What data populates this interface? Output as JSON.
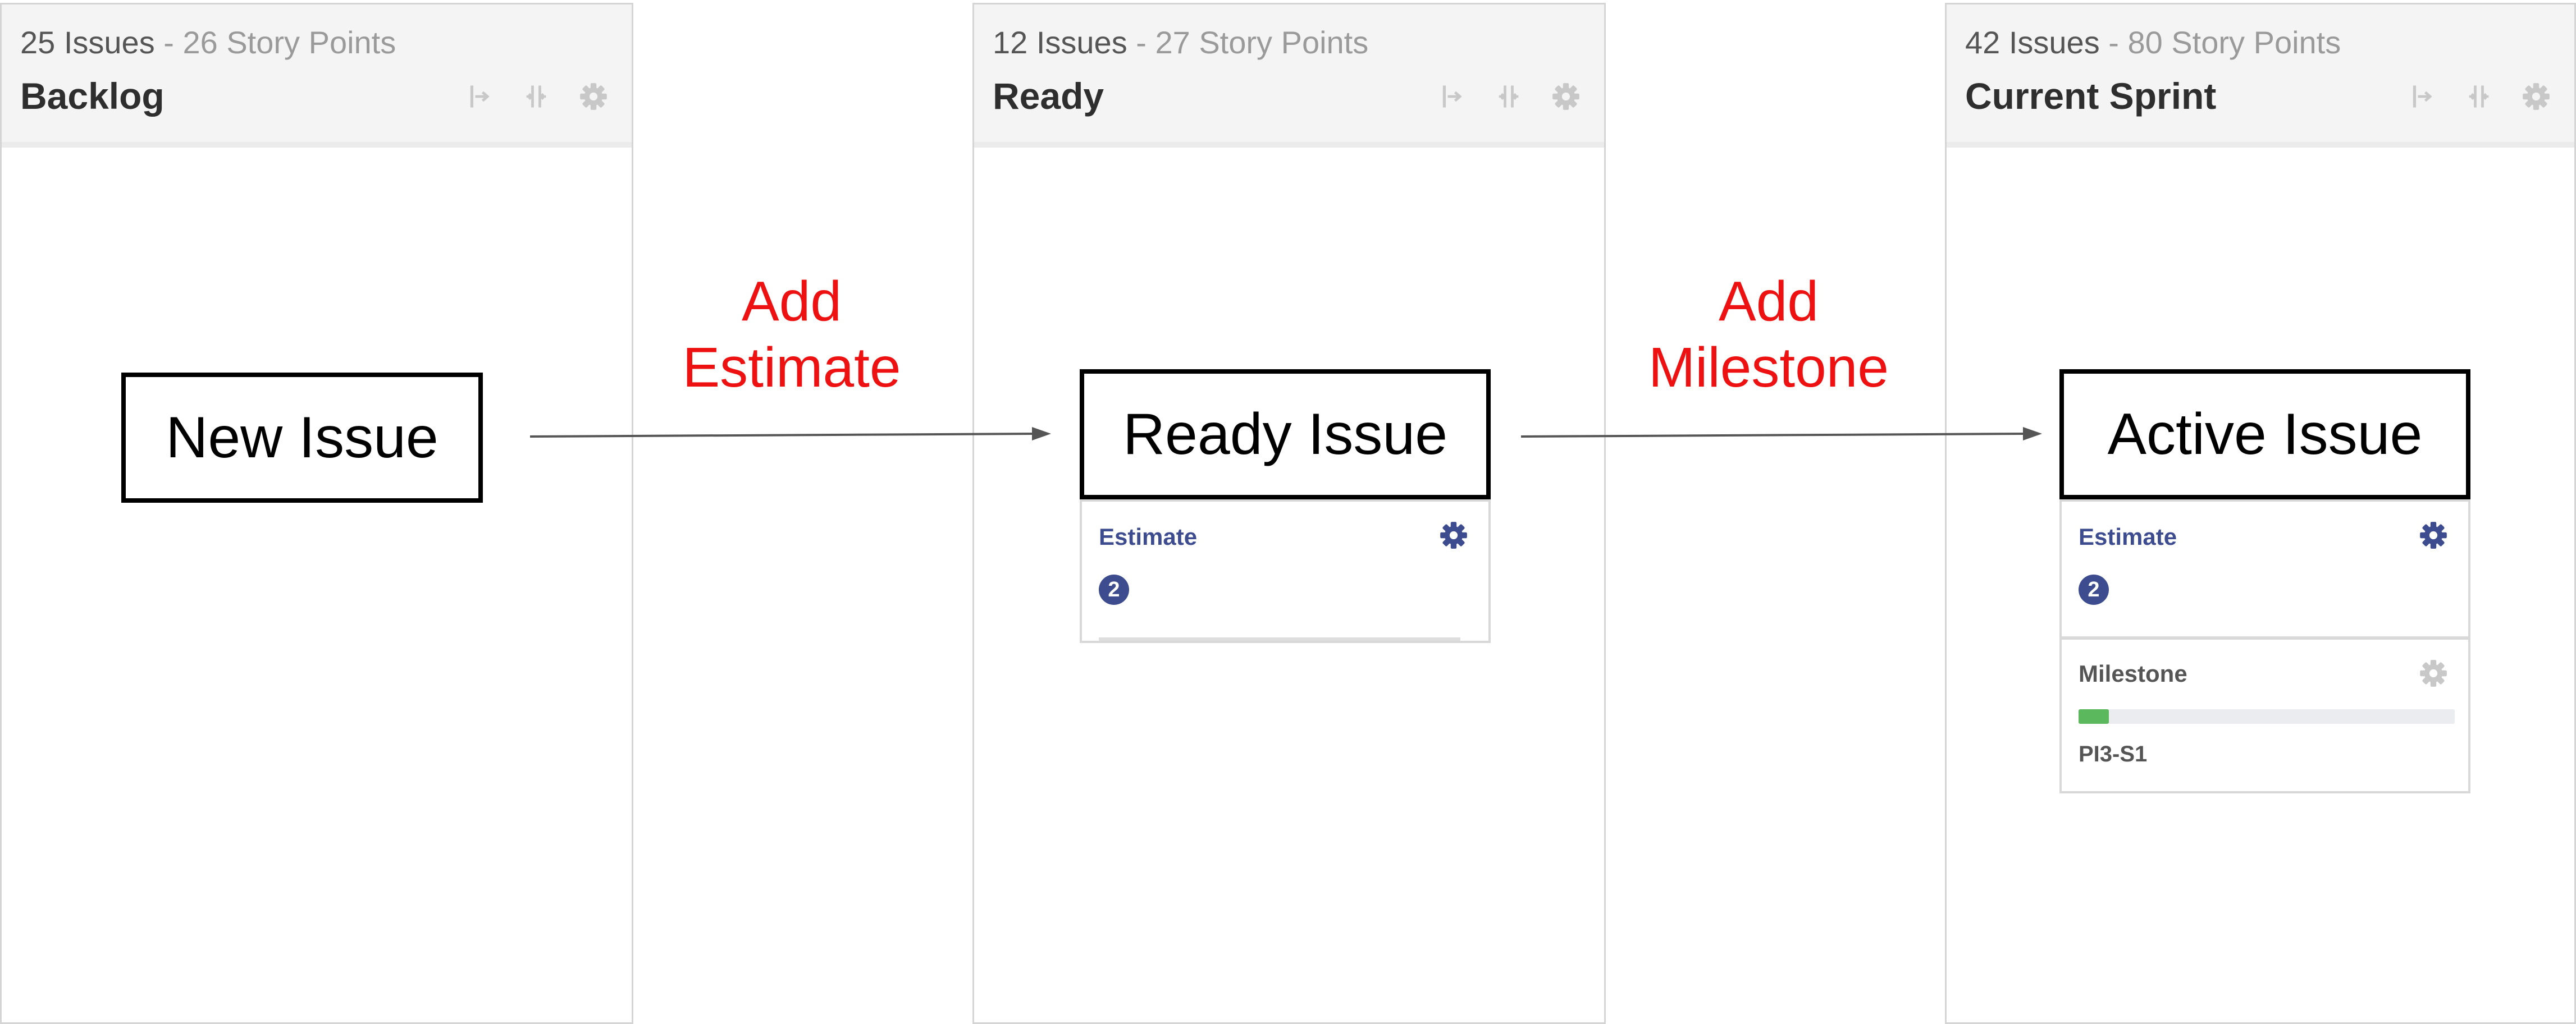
{
  "columns": {
    "backlog": {
      "issues": "25 Issues",
      "separator": "-",
      "points": "26 Story Points",
      "title": "Backlog"
    },
    "ready": {
      "issues": "12 Issues",
      "separator": "-",
      "points": "27 Story Points",
      "title": "Ready"
    },
    "sprint": {
      "issues": "42 Issues",
      "separator": "-",
      "points": "80 Story Points",
      "title": "Current Sprint"
    },
    "tool_icons": [
      "collapse-icon",
      "compress-icon",
      "gear-icon"
    ]
  },
  "stages": {
    "new": "New Issue",
    "ready": "Ready Issue",
    "active": "Active Issue"
  },
  "transitions": {
    "estimate": {
      "line1": "Add",
      "line2": "Estimate"
    },
    "milestone": {
      "line1": "Add",
      "line2": "Milestone"
    }
  },
  "panels": {
    "ready_estimate": {
      "label": "Estimate",
      "value": "2"
    },
    "active_estimate": {
      "label": "Estimate",
      "value": "2"
    },
    "milestone": {
      "label": "Milestone",
      "name": "PI3-S1",
      "progress_percent": 8
    }
  },
  "colors": {
    "accent": "#3d4b8f",
    "transition_text": "#ee1111",
    "progress_fill": "#5cb85c"
  }
}
